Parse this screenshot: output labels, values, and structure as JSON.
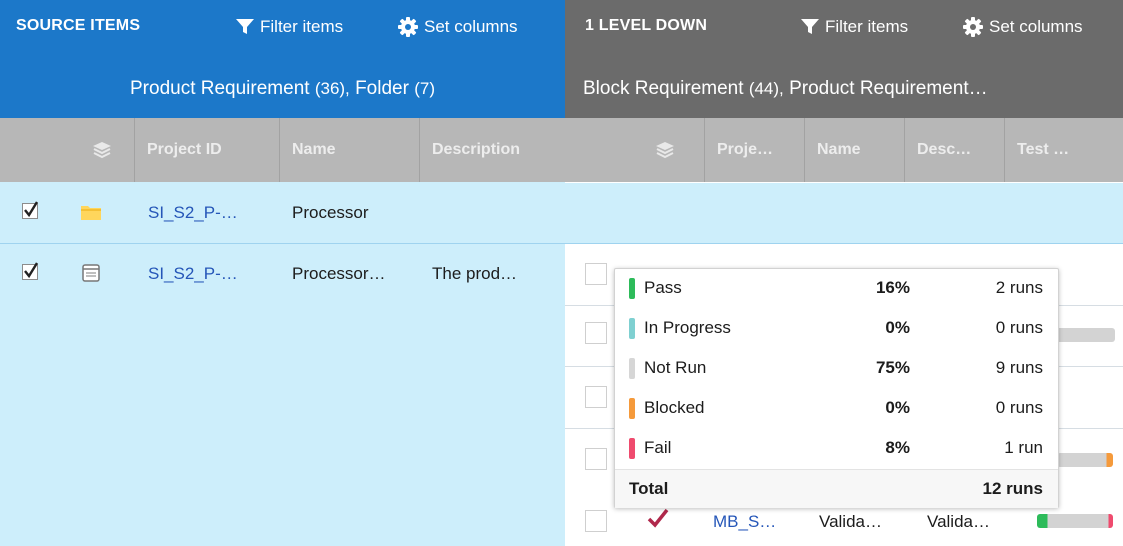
{
  "source_panel": {
    "title": "SOURCE ITEMS",
    "filter_label": "Filter items",
    "set_columns_label": "Set columns",
    "subtitle_main": "Product Requirement",
    "subtitle_main_count": "(36),",
    "subtitle_secondary": "Folder",
    "subtitle_secondary_count": "(7)",
    "columns": [
      "Project ID",
      "Name",
      "Description"
    ],
    "rows": [
      {
        "checked": true,
        "icon": "folder-icon",
        "project_id": "SI_S2_P-…",
        "name": "Processor",
        "description": ""
      },
      {
        "checked": true,
        "icon": "document-icon",
        "project_id": "SI_S2_P-…",
        "name": "Processor…",
        "description": "The prod…"
      }
    ]
  },
  "down_panel": {
    "title": "1 LEVEL DOWN",
    "filter_label": "Filter items",
    "set_columns_label": "Set columns",
    "subtitle_main": "Block Requirement",
    "subtitle_main_count": "(44),",
    "subtitle_secondary": "Product Requirement…",
    "columns": [
      "Proje…",
      "Name",
      "Desc…",
      "Test …"
    ],
    "last_row": {
      "project_id": "MB_S…",
      "name": "Valida…",
      "description": "Valida…"
    }
  },
  "test_runs_popup": {
    "rows": [
      {
        "label": "Pass",
        "percent": "16%",
        "runs": "2 runs",
        "color": "#2dbb5a"
      },
      {
        "label": "In Progress",
        "percent": "0%",
        "runs": "0 runs",
        "color": "#7fd0d1"
      },
      {
        "label": "Not Run",
        "percent": "75%",
        "runs": "9 runs",
        "color": "#d6d6d6"
      },
      {
        "label": "Blocked",
        "percent": "0%",
        "runs": "0 runs",
        "color": "#f59a3b"
      },
      {
        "label": "Fail",
        "percent": "8%",
        "runs": "1 run",
        "color": "#ef4b6e"
      }
    ],
    "total_label": "Total",
    "total_runs": "12 runs"
  },
  "colors": {
    "source_header": "#1c78c9",
    "down_header": "#6b6b6b",
    "column_header": "#b7b7b7",
    "source_body": "#cdeefb",
    "link": "#2556b8"
  }
}
